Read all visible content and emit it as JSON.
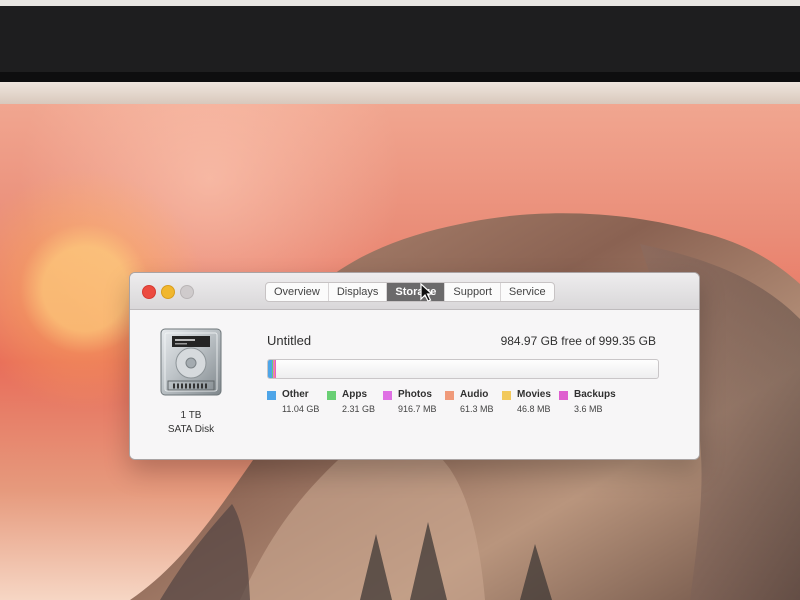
{
  "window": {
    "tabs": [
      {
        "label": "Overview",
        "active": false
      },
      {
        "label": "Displays",
        "active": false
      },
      {
        "label": "Storage",
        "active": true
      },
      {
        "label": "Support",
        "active": false
      },
      {
        "label": "Service",
        "active": false
      }
    ]
  },
  "storage": {
    "disk": {
      "capacity_label": "1 TB",
      "type_label": "SATA Disk",
      "icon": "hard-disk-icon"
    },
    "volume_name": "Untitled",
    "free_summary": "984.97 GB free of 999.35 GB",
    "usage": {
      "used_fraction": 0.0144,
      "segments": [
        {
          "name": "Other",
          "size": "11.04 GB",
          "color": "#4ea5e8",
          "fraction": 0.011
        },
        {
          "name": "Apps",
          "size": "2.31 GB",
          "color": "#69cf74",
          "fraction": 0.0023
        },
        {
          "name": "Photos",
          "size": "916.7 MB",
          "color": "#df70e4",
          "fraction": 0.0009
        },
        {
          "name": "Audio",
          "size": "61.3 MB",
          "color": "#f09a7a",
          "fraction": 0.0001
        },
        {
          "name": "Movies",
          "size": "46.8 MB",
          "color": "#f2c95c",
          "fraction": 5e-05
        },
        {
          "name": "Backups",
          "size": "3.6 MB",
          "color": "#df5fcf",
          "fraction": 1e-05
        }
      ]
    }
  }
}
